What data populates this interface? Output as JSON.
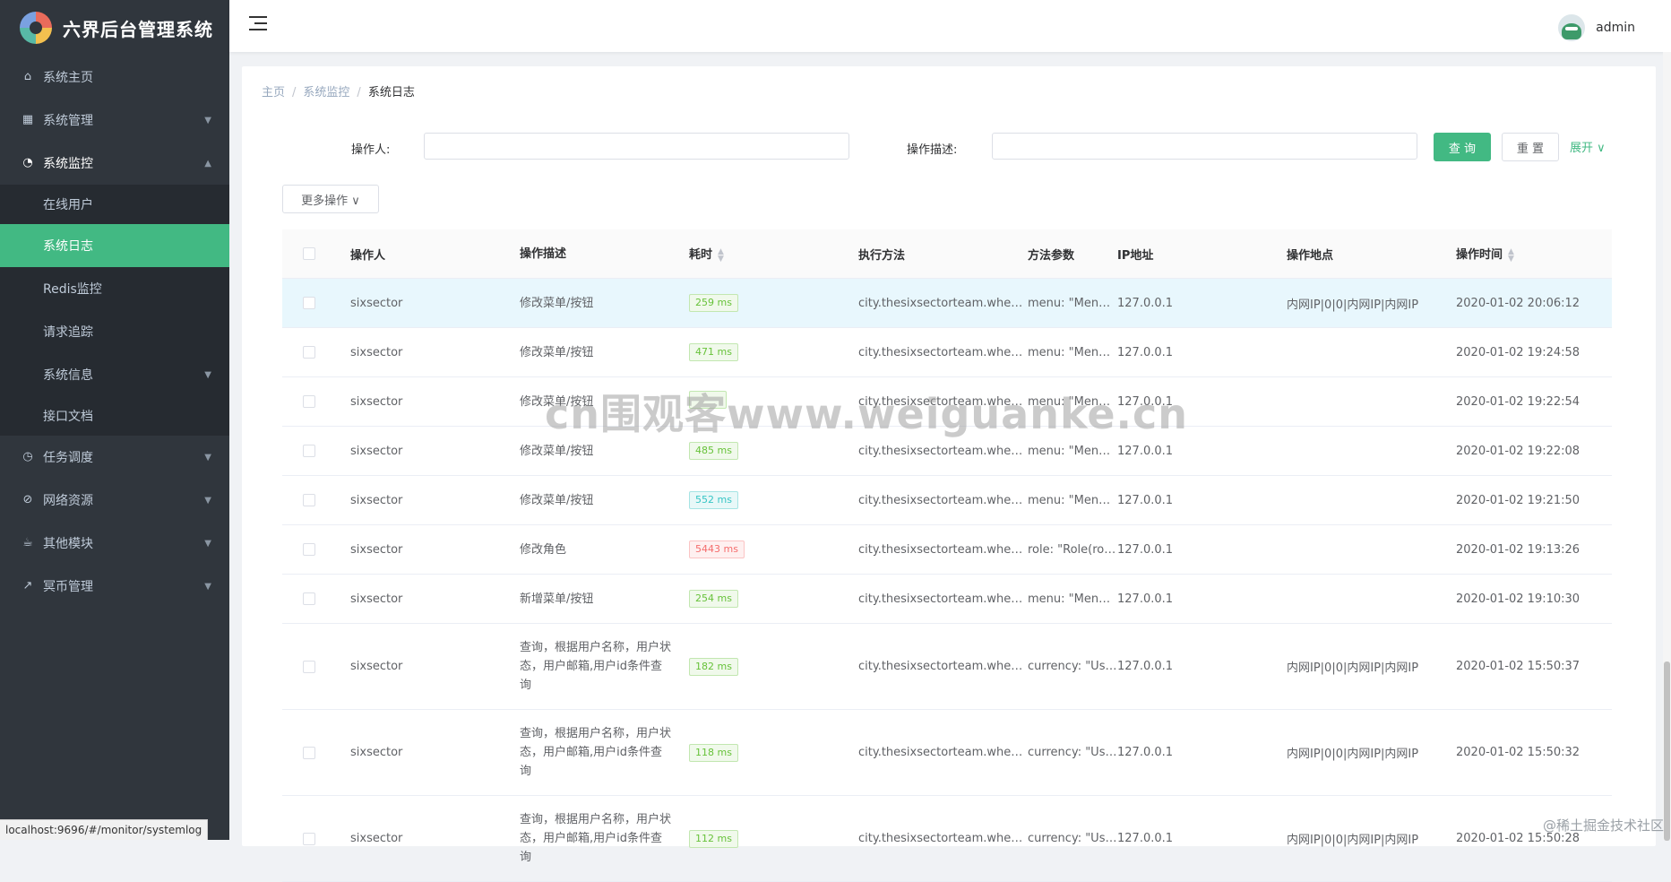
{
  "app": {
    "title": "六界后台管理系统"
  },
  "sidebar": {
    "items": [
      {
        "label": "系统主页",
        "icon": "home-icon"
      },
      {
        "label": "系统管理",
        "icon": "grid-icon"
      },
      {
        "label": "系统监控",
        "icon": "monitor-icon",
        "open": true,
        "children": [
          "在线用户",
          "系统日志",
          "Redis监控",
          "请求追踪",
          "系统信息",
          "接口文档"
        ]
      },
      {
        "label": "任务调度",
        "icon": "clock-icon"
      },
      {
        "label": "网络资源",
        "icon": "compass-icon"
      },
      {
        "label": "其他模块",
        "icon": "cup-icon"
      },
      {
        "label": "冥币管理",
        "icon": "chart-line-icon"
      }
    ]
  },
  "header": {
    "username": "admin"
  },
  "breadcrumb": [
    "主页",
    "系统监控",
    "系统日志"
  ],
  "breadcrumb_sep": "/",
  "search": {
    "operator_label": "操作人:",
    "desc_label": "操作描述:",
    "query_button": "查 询",
    "reset_button": "重 置",
    "expand_link": "展开 ∨",
    "more_ops": "更多操作 ∨"
  },
  "table": {
    "columns": [
      "操作人",
      "操作描述",
      "耗时",
      "执行方法",
      "方法参数",
      "IP地址",
      "操作地点",
      "操作时间"
    ],
    "rows": [
      {
        "user": "sixsector",
        "desc": "修改菜单/按钮",
        "time": "259 ms",
        "time_color": "green",
        "method": "city.thesixsectorteam.wheelwo...",
        "params": "menu: \"Menu(...",
        "ip": "127.0.0.1",
        "location": "内网IP|0|0|内网IP|内网IP",
        "date": "2020-01-02 20:06:12"
      },
      {
        "user": "sixsector",
        "desc": "修改菜单/按钮",
        "time": "471 ms",
        "time_color": "green",
        "method": "city.thesixsectorteam.wheelwo...",
        "params": "menu: \"Menu(...",
        "ip": "127.0.0.1",
        "location": "",
        "date": "2020-01-02 19:24:58"
      },
      {
        "user": "sixsector",
        "desc": "修改菜单/按钮",
        "time": "",
        "time_color": "green",
        "method": "city.thesixsectorteam.wheelwo...",
        "params": "menu: \"Menu(...",
        "ip": "127.0.0.1",
        "location": "",
        "date": "2020-01-02 19:22:54"
      },
      {
        "user": "sixsector",
        "desc": "修改菜单/按钮",
        "time": "485 ms",
        "time_color": "green",
        "method": "city.thesixsectorteam.wheelwo...",
        "params": "menu: \"Menu(...",
        "ip": "127.0.0.1",
        "location": "",
        "date": "2020-01-02 19:22:08"
      },
      {
        "user": "sixsector",
        "desc": "修改菜单/按钮",
        "time": "552 ms",
        "time_color": "cyan",
        "method": "city.thesixsectorteam.wheelwo...",
        "params": "menu: \"Menu(...",
        "ip": "127.0.0.1",
        "location": "",
        "date": "2020-01-02 19:21:50"
      },
      {
        "user": "sixsector",
        "desc": "修改角色",
        "time": "5443 ms",
        "time_color": "red",
        "method": "city.thesixsectorteam.wheelwo...",
        "params": "role: \"Role(rol...",
        "ip": "127.0.0.1",
        "location": "",
        "date": "2020-01-02 19:13:26"
      },
      {
        "user": "sixsector",
        "desc": "新增菜单/按钮",
        "time": "254 ms",
        "time_color": "green",
        "method": "city.thesixsectorteam.wheelwo...",
        "params": "menu: \"Menu(...",
        "ip": "127.0.0.1",
        "location": "",
        "date": "2020-01-02 19:10:30"
      },
      {
        "user": "sixsector",
        "desc": "查询，根据用户名称，用户状态，用户邮箱,用户id条件查询",
        "time": "182 ms",
        "time_color": "green",
        "method": "city.thesixsectorteam.wheelwo...",
        "params": "currency: \"Use...",
        "ip": "127.0.0.1",
        "location": "内网IP|0|0|内网IP|内网IP",
        "date": "2020-01-02 15:50:37"
      },
      {
        "user": "sixsector",
        "desc": "查询，根据用户名称，用户状态，用户邮箱,用户id条件查询",
        "time": "118 ms",
        "time_color": "green",
        "method": "city.thesixsectorteam.wheelwo...",
        "params": "currency: \"Use...",
        "ip": "127.0.0.1",
        "location": "内网IP|0|0|内网IP|内网IP",
        "date": "2020-01-02 15:50:32"
      },
      {
        "user": "sixsector",
        "desc": "查询，根据用户名称，用户状态，用户邮箱,用户id条件查询",
        "time": "112 ms",
        "time_color": "green",
        "method": "city.thesixsectorteam.wheelwo...",
        "params": "currency: \"Use...",
        "ip": "127.0.0.1",
        "location": "内网IP|0|0|内网IP|内网IP",
        "date": "2020-01-02 15:50:28"
      }
    ]
  },
  "status_bar": {
    "url": "localhost:9696/#/monitor/systemlog"
  },
  "watermark": {
    "center": "cn围观客www.weiguanke.cn",
    "corner": "@稀土掘金技术社区"
  },
  "colors": {
    "accent": "#42b983",
    "sidebar_bg": "#30363d",
    "submenu_bg": "#262b31"
  }
}
